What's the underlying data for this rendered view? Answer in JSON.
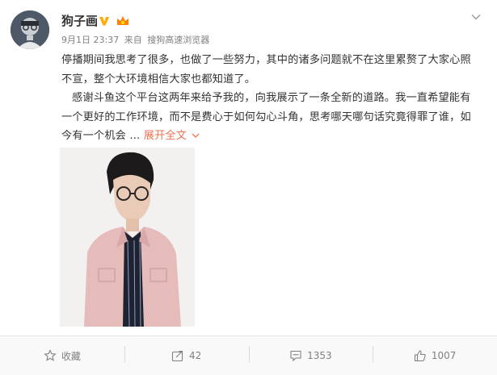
{
  "post": {
    "username": "狗子画",
    "date": "9月1日 23:37",
    "source_prefix": "来自",
    "source": "搜狗高速浏览器",
    "paragraph1": "停播期间我思考了很多，也做了一些努力，其中的诸多问题就不在这里累赘了大家心照不宣，整个大环境相信大家也都知道了。",
    "paragraph2": "感谢斗鱼这个平台这两年来给予我的，向我展示了一条全新的道路。我一直希望能有一个更好的工作环境，而不是费心于如何勾心斗角，思考哪天哪句话究竟得罪了谁，如今有一个机会 ...",
    "expand_label": "展开全文"
  },
  "footer": {
    "favorite_label": "收藏",
    "repost_count": "42",
    "comment_count": "1353",
    "like_count": "1007"
  },
  "icons": {
    "verified": "verified-v-icon",
    "vip": "vip-crown-icon",
    "menu": "chevron-down-icon",
    "favorite": "star-icon",
    "repost": "share-icon",
    "comment": "comment-icon",
    "like": "thumbs-up-icon"
  },
  "colors": {
    "accent": "#eb7350",
    "verified": "#ffab00",
    "meta_text": "#808080"
  }
}
